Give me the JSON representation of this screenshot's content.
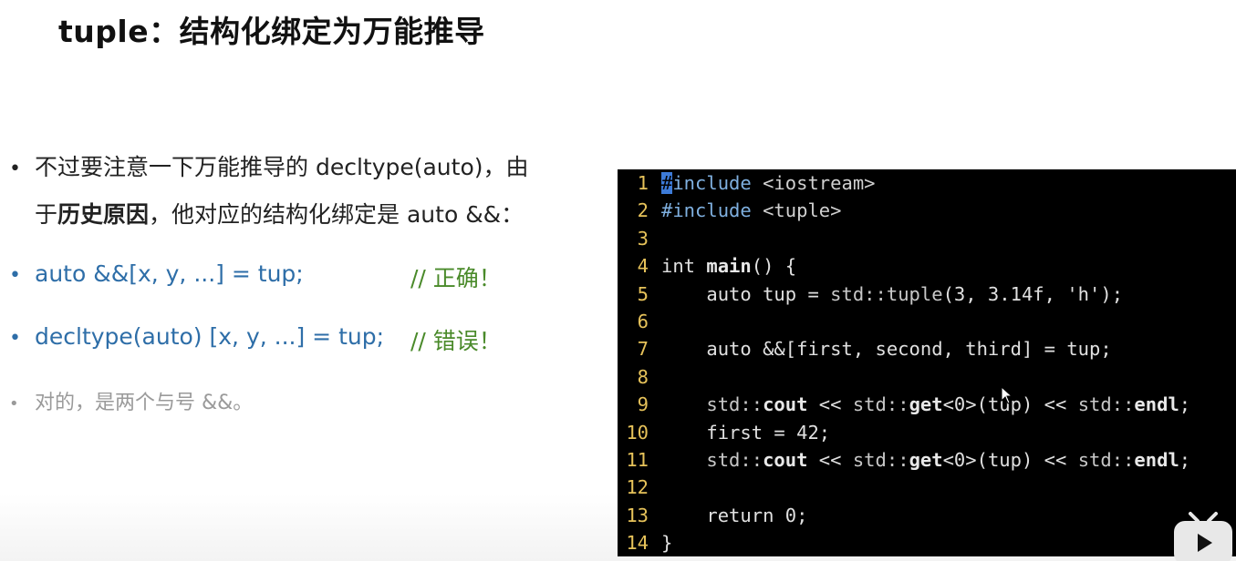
{
  "slide": {
    "title": "tuple：结构化绑定为万能推导",
    "bullets": {
      "b1_line1": "不过要注意一下万能推导的 decltype(auto)，由",
      "b1_line2_pre": "于",
      "b1_line2_bold": "历史原因",
      "b1_line2_post": "，他对应的结构化绑定是 auto &&：",
      "b2_code": "auto &&[x, y, ...] = tup;",
      "b2_comment": "// 正确！",
      "b3_code": "decltype(auto) [x, y, ...] = tup;",
      "b3_comment": "// 错误！",
      "b4": "对的，是两个与号 &&。"
    },
    "bullet_glyph": "•"
  },
  "code_editor": {
    "lines": [
      {
        "n": "1",
        "text": "#include <iostream>"
      },
      {
        "n": "2",
        "text": "#include <tuple>"
      },
      {
        "n": "3",
        "text": ""
      },
      {
        "n": "4",
        "text": "int main() {"
      },
      {
        "n": "5",
        "text": "    auto tup = std::tuple(3, 3.14f, 'h');"
      },
      {
        "n": "6",
        "text": ""
      },
      {
        "n": "7",
        "text": "    auto &&[first, second, third] = tup;"
      },
      {
        "n": "8",
        "text": ""
      },
      {
        "n": "9",
        "text": "    std::cout << std::get<0>(tup) << std::endl;"
      },
      {
        "n": "10",
        "text": "    first = 42;"
      },
      {
        "n": "11",
        "text": "    std::cout << std::get<0>(tup) << std::endl;"
      },
      {
        "n": "12",
        "text": ""
      },
      {
        "n": "13",
        "text": "    return 0;"
      },
      {
        "n": "14",
        "text": "}"
      }
    ]
  },
  "colors": {
    "line_number": "#e6c25a",
    "preprocessor": "#7fb0e0",
    "cursor": "#3d7bd8",
    "bullet_blue": "#2e6ea8",
    "comment_green": "#4a8a2a",
    "muted_gray": "#9a9a9a",
    "logo_pink": "#fb7299"
  },
  "icons": {
    "watermark": "bilibili-tv-icon",
    "pointer": "mouse-cursor-icon"
  }
}
